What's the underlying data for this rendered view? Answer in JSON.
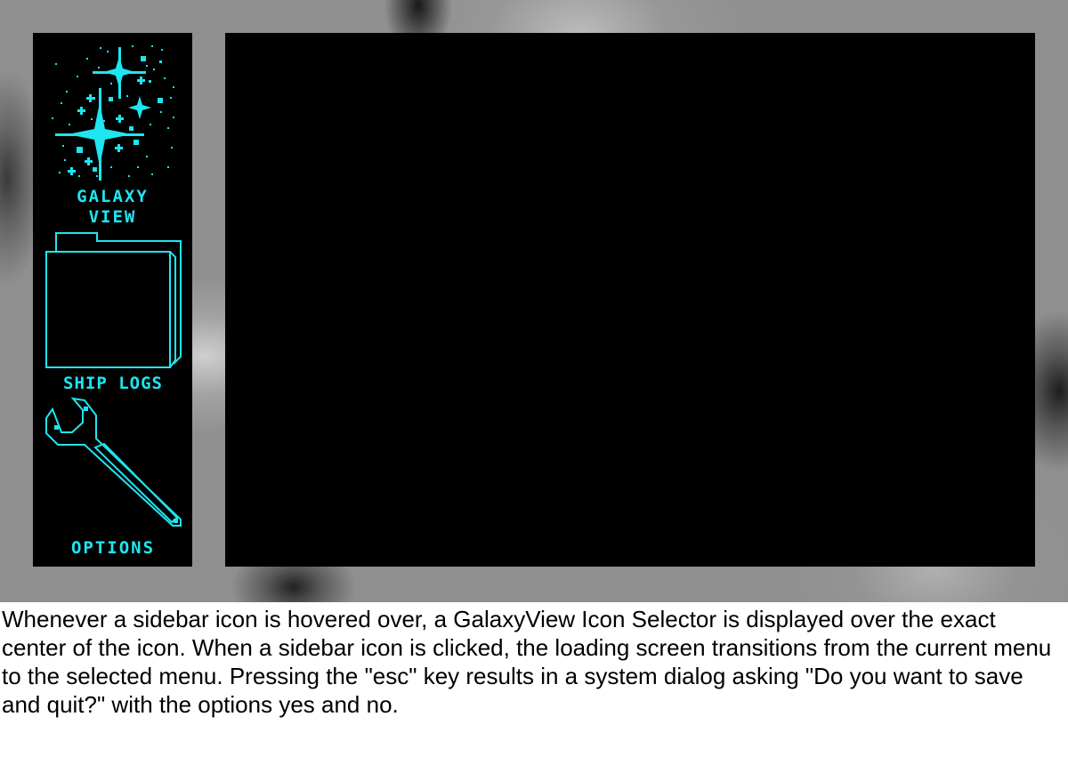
{
  "sidebar": {
    "items": [
      {
        "id": "galaxy-view",
        "label": "GALAXY\nVIEW",
        "icon": "sparkle-stars-icon"
      },
      {
        "id": "ship-logs",
        "label": "SHIP LOGS",
        "icon": "folder-icon"
      },
      {
        "id": "options",
        "label": "OPTIONS",
        "icon": "wrench-icon"
      }
    ]
  },
  "colors": {
    "accent": "#1ee6f0",
    "panel": "#000000",
    "backdrop": "#8f8f8f"
  },
  "description": "Whenever a sidebar icon is hovered over, a GalaxyView Icon Selector is displayed over the exact center of the icon. When a sidebar icon is clicked, the loading screen transitions from the current menu to the selected menu. Pressing the \"esc\" key results in a system dialog asking \"Do you want to save and quit?\" with the options yes and no."
}
